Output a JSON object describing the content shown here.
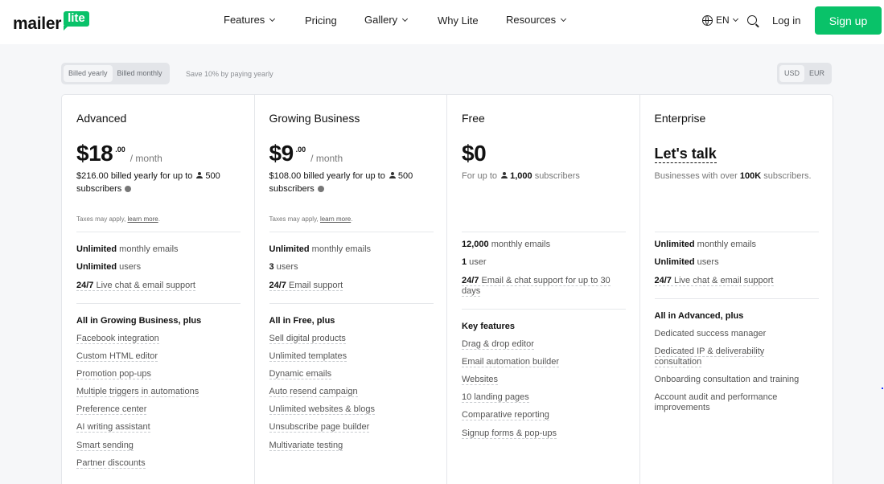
{
  "header": {
    "logo_word": "mailer",
    "logo_badge": "lite",
    "nav": [
      {
        "label": "Features",
        "dropdown": true
      },
      {
        "label": "Pricing",
        "dropdown": false
      },
      {
        "label": "Gallery",
        "dropdown": true
      },
      {
        "label": "Why Lite",
        "dropdown": false
      },
      {
        "label": "Resources",
        "dropdown": true
      }
    ],
    "language": "EN",
    "login_label": "Log in",
    "signup_label": "Sign up",
    "brand_color": "#09c269"
  },
  "billing": {
    "options": [
      "Billed yearly",
      "Billed monthly"
    ],
    "selected": "Billed yearly",
    "save_note": "Save 10% by paying yearly"
  },
  "currency": {
    "options": [
      "USD",
      "EUR"
    ],
    "selected": "USD"
  },
  "plans": [
    {
      "name": "Advanced",
      "price": "$18",
      "cents": ".00",
      "period": "/ month",
      "billed_prefix": "$216.00 billed yearly for up to",
      "subscribers": "500",
      "billed_suffix": "subscribers",
      "taxes_text": "Taxes may apply,",
      "taxes_link": "learn more",
      "features": [
        {
          "bold": "Unlimited",
          "text": " monthly emails"
        },
        {
          "bold": "Unlimited",
          "text": " users"
        },
        {
          "bold": "24/7",
          "text": " Live chat & email support"
        }
      ],
      "section_title": "All in Growing Business, plus",
      "items": [
        "Facebook integration",
        "Custom HTML editor",
        "Promotion pop-ups",
        "Multiple triggers in automations",
        "Preference center",
        "AI writing assistant",
        "Smart sending",
        "Partner discounts"
      ]
    },
    {
      "name": "Growing Business",
      "price": "$9",
      "cents": ".00",
      "period": "/ month",
      "billed_prefix": "$108.00 billed yearly for up to",
      "subscribers": "500",
      "billed_suffix": "subscribers",
      "taxes_text": "Taxes may apply,",
      "taxes_link": "learn more",
      "features": [
        {
          "bold": "Unlimited",
          "text": " monthly emails"
        },
        {
          "bold": "3",
          "text": " users"
        },
        {
          "bold": "24/7",
          "text": " Email support"
        }
      ],
      "section_title": "All in Free, plus",
      "items": [
        "Sell digital products",
        "Unlimited templates",
        "Dynamic emails",
        "Auto resend campaign",
        "Unlimited websites & blogs",
        "Unsubscribe page builder",
        "Multivariate testing"
      ]
    },
    {
      "name": "Free",
      "price": "$0",
      "billed_prefix": "For up to",
      "subscribers": "1,000",
      "billed_suffix": "subscribers",
      "features": [
        {
          "bold": "12,000",
          "text": " monthly emails"
        },
        {
          "bold": "1",
          "text": " user"
        },
        {
          "bold": "24/7",
          "text": " Email & chat support for up to 30 days"
        }
      ],
      "section_title": "Key features",
      "items": [
        "Drag & drop editor",
        "Email automation builder",
        "Websites",
        "10 landing pages",
        "Comparative reporting",
        "Signup forms & pop-ups"
      ]
    },
    {
      "name": "Enterprise",
      "price_text": "Let's talk",
      "desc_prefix": "Businesses with over",
      "desc_bold": "100K",
      "desc_suffix": "subscribers.",
      "features": [
        {
          "bold": "Unlimited",
          "text": " monthly emails"
        },
        {
          "bold": "Unlimited",
          "text": " users"
        },
        {
          "bold": "24/7",
          "text": " Live chat & email support"
        }
      ],
      "section_title": "All in Advanced, plus",
      "items": [
        "Dedicated success manager",
        "Dedicated IP & deliverability consultation",
        "Onboarding consultation and training",
        "Account audit and performance improvements"
      ]
    }
  ]
}
